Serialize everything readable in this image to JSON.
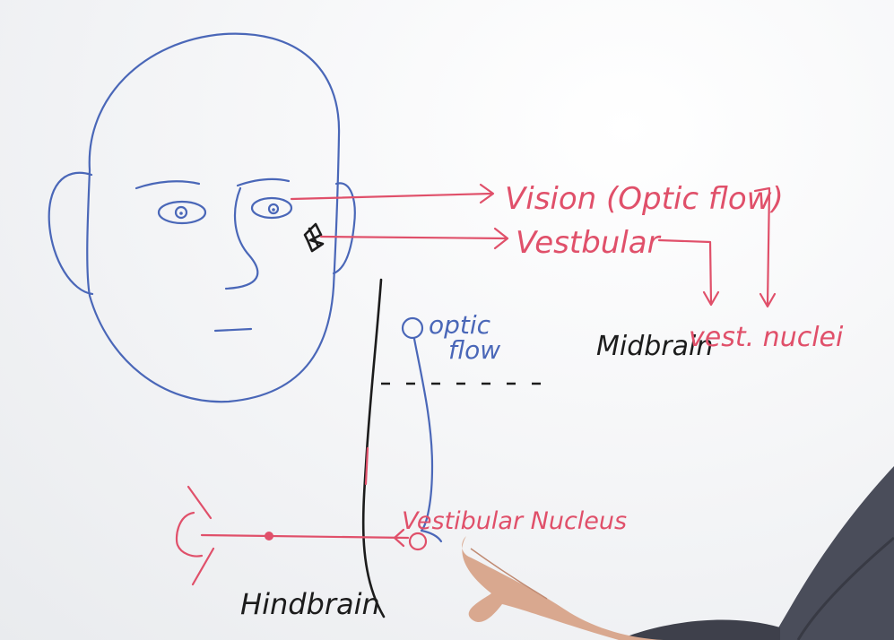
{
  "labels": {
    "vision": "Vision (Optic flow)",
    "vestibular": "Vestbular",
    "midbrain": "Midbrain",
    "vest_nuclei": "vest. nuclei",
    "optic_line1": "optic",
    "optic_line2": "flow",
    "vestibular_nucleus": "Vestibular Nucleus",
    "hindbrain": "Hindbrain"
  },
  "colors": {
    "blue_marker": "#4a67b8",
    "red_marker": "#e0506a",
    "black_marker": "#1c1c1c"
  }
}
